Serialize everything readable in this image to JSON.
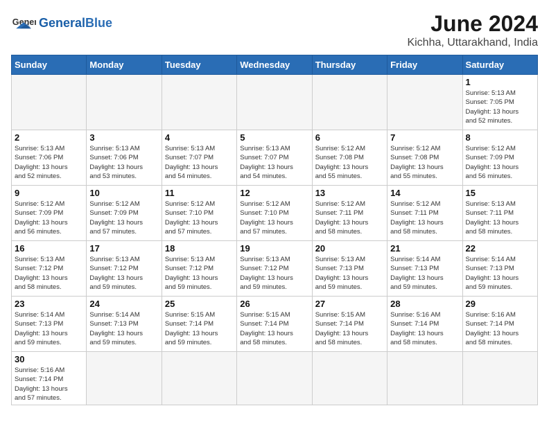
{
  "logo": {
    "general": "General",
    "blue": "Blue"
  },
  "header": {
    "month": "June 2024",
    "location": "Kichha, Uttarakhand, India"
  },
  "weekdays": [
    "Sunday",
    "Monday",
    "Tuesday",
    "Wednesday",
    "Thursday",
    "Friday",
    "Saturday"
  ],
  "weeks": [
    [
      {
        "day": "",
        "info": ""
      },
      {
        "day": "",
        "info": ""
      },
      {
        "day": "",
        "info": ""
      },
      {
        "day": "",
        "info": ""
      },
      {
        "day": "",
        "info": ""
      },
      {
        "day": "",
        "info": ""
      },
      {
        "day": "1",
        "info": "Sunrise: 5:13 AM\nSunset: 7:05 PM\nDaylight: 13 hours\nand 52 minutes."
      }
    ],
    [
      {
        "day": "2",
        "info": "Sunrise: 5:13 AM\nSunset: 7:06 PM\nDaylight: 13 hours\nand 52 minutes."
      },
      {
        "day": "3",
        "info": "Sunrise: 5:13 AM\nSunset: 7:06 PM\nDaylight: 13 hours\nand 53 minutes."
      },
      {
        "day": "4",
        "info": "Sunrise: 5:13 AM\nSunset: 7:07 PM\nDaylight: 13 hours\nand 54 minutes."
      },
      {
        "day": "5",
        "info": "Sunrise: 5:13 AM\nSunset: 7:07 PM\nDaylight: 13 hours\nand 54 minutes."
      },
      {
        "day": "6",
        "info": "Sunrise: 5:12 AM\nSunset: 7:08 PM\nDaylight: 13 hours\nand 55 minutes."
      },
      {
        "day": "7",
        "info": "Sunrise: 5:12 AM\nSunset: 7:08 PM\nDaylight: 13 hours\nand 55 minutes."
      },
      {
        "day": "8",
        "info": "Sunrise: 5:12 AM\nSunset: 7:09 PM\nDaylight: 13 hours\nand 56 minutes."
      }
    ],
    [
      {
        "day": "9",
        "info": "Sunrise: 5:12 AM\nSunset: 7:09 PM\nDaylight: 13 hours\nand 56 minutes."
      },
      {
        "day": "10",
        "info": "Sunrise: 5:12 AM\nSunset: 7:09 PM\nDaylight: 13 hours\nand 57 minutes."
      },
      {
        "day": "11",
        "info": "Sunrise: 5:12 AM\nSunset: 7:10 PM\nDaylight: 13 hours\nand 57 minutes."
      },
      {
        "day": "12",
        "info": "Sunrise: 5:12 AM\nSunset: 7:10 PM\nDaylight: 13 hours\nand 57 minutes."
      },
      {
        "day": "13",
        "info": "Sunrise: 5:12 AM\nSunset: 7:11 PM\nDaylight: 13 hours\nand 58 minutes."
      },
      {
        "day": "14",
        "info": "Sunrise: 5:12 AM\nSunset: 7:11 PM\nDaylight: 13 hours\nand 58 minutes."
      },
      {
        "day": "15",
        "info": "Sunrise: 5:13 AM\nSunset: 7:11 PM\nDaylight: 13 hours\nand 58 minutes."
      }
    ],
    [
      {
        "day": "16",
        "info": "Sunrise: 5:13 AM\nSunset: 7:12 PM\nDaylight: 13 hours\nand 58 minutes."
      },
      {
        "day": "17",
        "info": "Sunrise: 5:13 AM\nSunset: 7:12 PM\nDaylight: 13 hours\nand 59 minutes."
      },
      {
        "day": "18",
        "info": "Sunrise: 5:13 AM\nSunset: 7:12 PM\nDaylight: 13 hours\nand 59 minutes."
      },
      {
        "day": "19",
        "info": "Sunrise: 5:13 AM\nSunset: 7:12 PM\nDaylight: 13 hours\nand 59 minutes."
      },
      {
        "day": "20",
        "info": "Sunrise: 5:13 AM\nSunset: 7:13 PM\nDaylight: 13 hours\nand 59 minutes."
      },
      {
        "day": "21",
        "info": "Sunrise: 5:14 AM\nSunset: 7:13 PM\nDaylight: 13 hours\nand 59 minutes."
      },
      {
        "day": "22",
        "info": "Sunrise: 5:14 AM\nSunset: 7:13 PM\nDaylight: 13 hours\nand 59 minutes."
      }
    ],
    [
      {
        "day": "23",
        "info": "Sunrise: 5:14 AM\nSunset: 7:13 PM\nDaylight: 13 hours\nand 59 minutes."
      },
      {
        "day": "24",
        "info": "Sunrise: 5:14 AM\nSunset: 7:13 PM\nDaylight: 13 hours\nand 59 minutes."
      },
      {
        "day": "25",
        "info": "Sunrise: 5:15 AM\nSunset: 7:14 PM\nDaylight: 13 hours\nand 59 minutes."
      },
      {
        "day": "26",
        "info": "Sunrise: 5:15 AM\nSunset: 7:14 PM\nDaylight: 13 hours\nand 58 minutes."
      },
      {
        "day": "27",
        "info": "Sunrise: 5:15 AM\nSunset: 7:14 PM\nDaylight: 13 hours\nand 58 minutes."
      },
      {
        "day": "28",
        "info": "Sunrise: 5:16 AM\nSunset: 7:14 PM\nDaylight: 13 hours\nand 58 minutes."
      },
      {
        "day": "29",
        "info": "Sunrise: 5:16 AM\nSunset: 7:14 PM\nDaylight: 13 hours\nand 58 minutes."
      }
    ],
    [
      {
        "day": "30",
        "info": "Sunrise: 5:16 AM\nSunset: 7:14 PM\nDaylight: 13 hours\nand 57 minutes."
      },
      {
        "day": "",
        "info": ""
      },
      {
        "day": "",
        "info": ""
      },
      {
        "day": "",
        "info": ""
      },
      {
        "day": "",
        "info": ""
      },
      {
        "day": "",
        "info": ""
      },
      {
        "day": "",
        "info": ""
      }
    ]
  ]
}
